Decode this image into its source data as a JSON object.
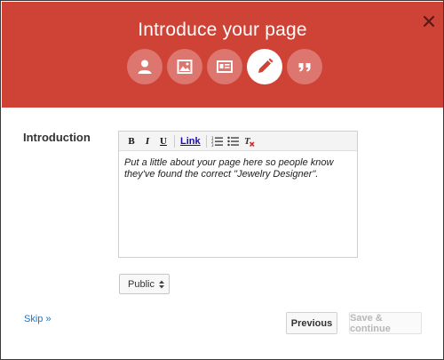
{
  "dialog": {
    "title": "Introduce your page",
    "close_icon": "close-icon",
    "steps": [
      {
        "icon": "person-icon",
        "active": false
      },
      {
        "icon": "image-icon",
        "active": false
      },
      {
        "icon": "contact-card-icon",
        "active": false
      },
      {
        "icon": "pencil-icon",
        "active": true
      },
      {
        "icon": "quote-icon",
        "active": false
      }
    ]
  },
  "form": {
    "label": "Introduction",
    "toolbar": {
      "bold": "B",
      "italic": "I",
      "underline": "U",
      "link": "Link"
    },
    "editor_text": "Put a little about your page here so people know they've found the correct \"Jewelry Designer\".",
    "visibility": {
      "selected": "Public"
    }
  },
  "footer": {
    "skip": "Skip »",
    "previous": "Previous",
    "save_continue": "Save & continue"
  },
  "colors": {
    "header_bg": "#cf4236",
    "link": "#1a73c8"
  }
}
